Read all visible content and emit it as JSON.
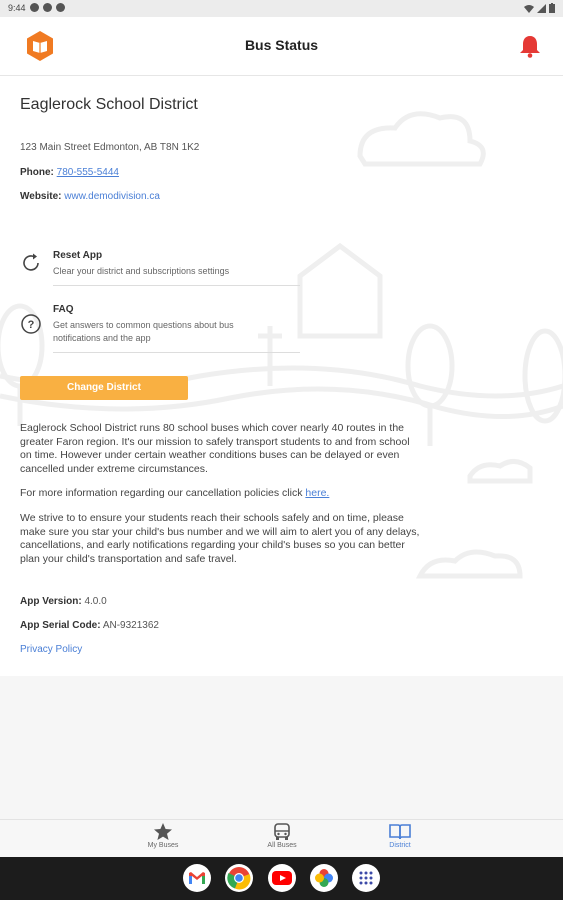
{
  "status_bar": {
    "time": "9:44"
  },
  "app_bar": {
    "title": "Bus Status"
  },
  "district": {
    "name": "Eaglerock School District",
    "address": "123 Main Street Edmonton, AB T8N 1K2",
    "phone_label": "Phone:",
    "phone": "780-555-5444",
    "website_label": "Website:",
    "website": "www.demodivision.ca"
  },
  "menu": [
    {
      "title": "Reset App",
      "desc": "Clear your district and subscriptions settings",
      "icon": "refresh-icon"
    },
    {
      "title": "FAQ",
      "desc": "Get answers to common questions about bus notifications and the app",
      "icon": "question-icon"
    }
  ],
  "change_district_label": "Change District",
  "paragraphs": {
    "p1": "Eaglerock School District runs 80 school buses which cover nearly 40 routes in the greater Faron region. It's our mission to safely transport students to and from school on time. However under certain weather conditions buses can be delayed or even cancelled under extreme circumstances.",
    "p2_text": "For more information regarding our cancellation policies click ",
    "p2_link": "here.",
    "p3": "We strive to to ensure your students reach their schools safely and on time, please make sure you star your child's bus number and we will aim to alert you of any delays, cancellations, and early notifications regarding your child's buses so you can better plan your child's transportation and safe travel."
  },
  "app_info": {
    "version_label": "App Version:",
    "version": "4.0.0",
    "serial_label": "App Serial Code:",
    "serial": "AN-9321362",
    "privacy_label": "Privacy Policy"
  },
  "bottom_nav": [
    {
      "label": "My Buses",
      "icon": "star-icon"
    },
    {
      "label": "All Buses",
      "icon": "bus-icon"
    },
    {
      "label": "District",
      "icon": "book-icon"
    }
  ],
  "dock_apps": [
    "Gmail",
    "Chrome",
    "YouTube",
    "Photos",
    "Apps"
  ],
  "colors": {
    "accent_orange": "#f9b042",
    "logo_orange": "#f07a22",
    "bell_red": "#e53935",
    "link_blue": "#4a7fd6",
    "active_nav": "#4a7fd6"
  }
}
